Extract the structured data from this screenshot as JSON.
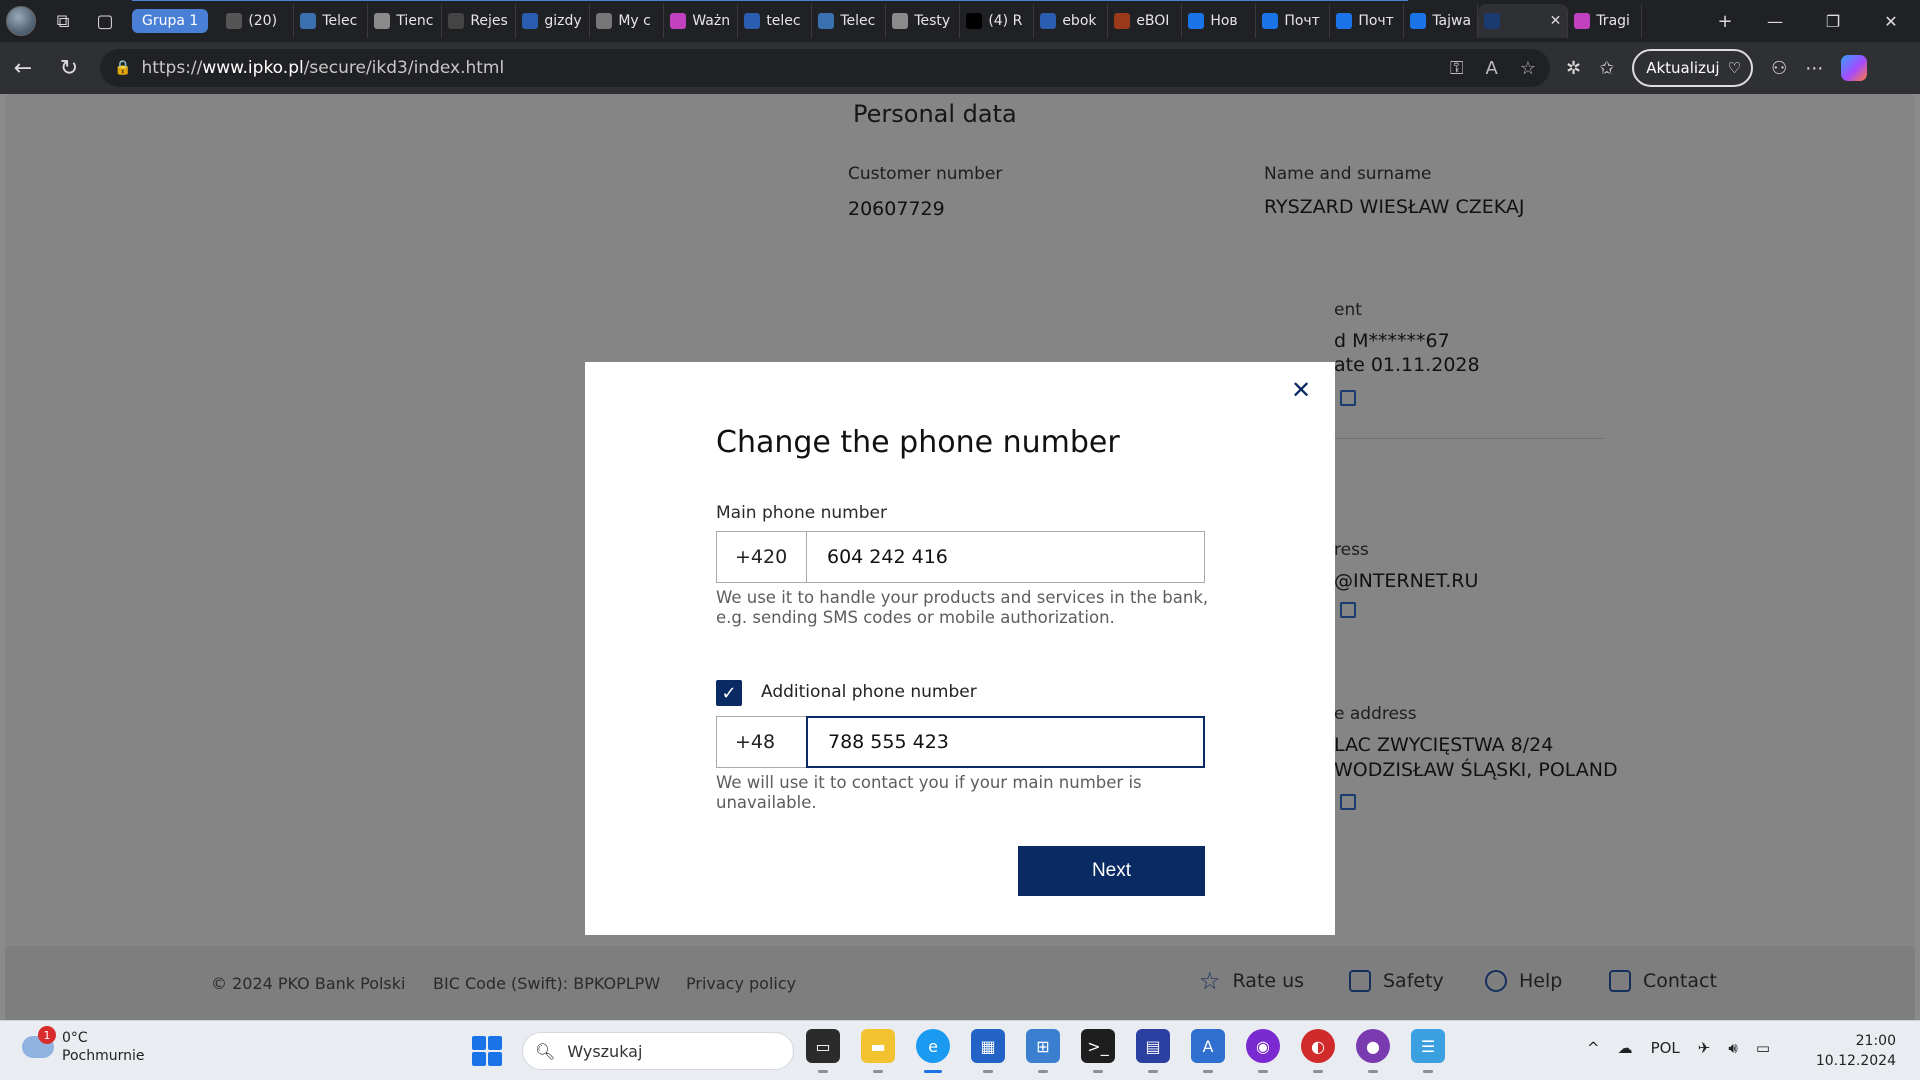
{
  "browser": {
    "group_label": "Grupa 1",
    "tabs": [
      {
        "label": "(20)",
        "icon": "reddit-icon",
        "color": "#555555"
      },
      {
        "label": "Telec",
        "icon": "network-icon",
        "color": "#3a6fb0"
      },
      {
        "label": "Tienc",
        "icon": "p-icon",
        "color": "#8a8a8a"
      },
      {
        "label": "Rejes",
        "icon": "eye-icon",
        "color": "#444444"
      },
      {
        "label": "gizdy",
        "icon": "search-icon",
        "color": "#2a5db0"
      },
      {
        "label": "My c",
        "icon": "shield-icon",
        "color": "#777777"
      },
      {
        "label": "Ważn",
        "icon": "butterfly-icon",
        "color": "#c040c0"
      },
      {
        "label": "telec",
        "icon": "search-icon",
        "color": "#2a5db0"
      },
      {
        "label": "Telec",
        "icon": "network-icon",
        "color": "#3a6fb0"
      },
      {
        "label": "Testy",
        "icon": "p-icon",
        "color": "#8a8a8a"
      },
      {
        "label": "(4) R",
        "icon": "x-icon",
        "color": "#000000"
      },
      {
        "label": "ebok",
        "icon": "search-icon",
        "color": "#2a5db0"
      },
      {
        "label": "eBOI",
        "icon": "leaf-icon",
        "color": "#9a3a1a"
      },
      {
        "label": "Нов",
        "icon": "at-icon",
        "color": "#1a74e8"
      },
      {
        "label": "Почт",
        "icon": "mail-icon",
        "color": "#1a74e8"
      },
      {
        "label": "Почт",
        "icon": "mail-icon",
        "color": "#1a74e8"
      },
      {
        "label": "Tajwa",
        "icon": "edge-icon",
        "color": "#1a74e8"
      },
      {
        "label": "",
        "icon": "pko-icon",
        "color": "#1a3a70"
      },
      {
        "label": "Tragi",
        "icon": "butterfly-icon",
        "color": "#c040c0"
      }
    ],
    "url_prefix": "https://",
    "url_host": "www.ipko.pl",
    "url_path": "/secure/ikd3/index.html",
    "update_label": "Aktualizuj"
  },
  "personal_data": {
    "title": "Personal data",
    "customer_number_label": "Customer number",
    "customer_number": "20607729",
    "name_label": "Name and surname",
    "name": "RYSZARD WIESŁAW CZEKAJ",
    "document_label_partial": "ent",
    "document_value_partial": "d M******67",
    "document_expiry_partial": "ate 01.11.2028",
    "email_label_partial": "ress",
    "email_partial": "@INTERNET.RU",
    "address_label_partial": "e address",
    "address_line1_partial": "LAC ZWYCIĘSTWA 8/24",
    "address_line2_partial": "WODZISŁAW ŚLĄSKI, POLAND"
  },
  "modal": {
    "title": "Change the phone number",
    "main_label": "Main phone number",
    "main_prefix": "+420",
    "main_number": "604 242 416",
    "main_hint": "We use it to handle your products and services in the bank, e.g. sending SMS codes or mobile authorization.",
    "additional_label": "Additional phone number",
    "additional_checked": true,
    "additional_prefix": "+48",
    "additional_number": "788 555 423",
    "additional_hint": "We will use it to contact you if your main number is unavailable.",
    "next_label": "Next",
    "accent_color": "#0a2a63"
  },
  "footer": {
    "copyright": "© 2024 PKO Bank Polski",
    "bic": "BIC Code (Swift): BPKOPLPW",
    "privacy": "Privacy policy",
    "rate_us": "Rate us",
    "safety": "Safety",
    "help": "Help",
    "contact": "Contact"
  },
  "taskbar": {
    "weather_badge": "1",
    "temperature": "0°C",
    "weather_desc": "Pochmurnie",
    "search_placeholder": "Wyszukaj",
    "language": "POL",
    "time": "21:00",
    "date": "10.12.2024"
  }
}
